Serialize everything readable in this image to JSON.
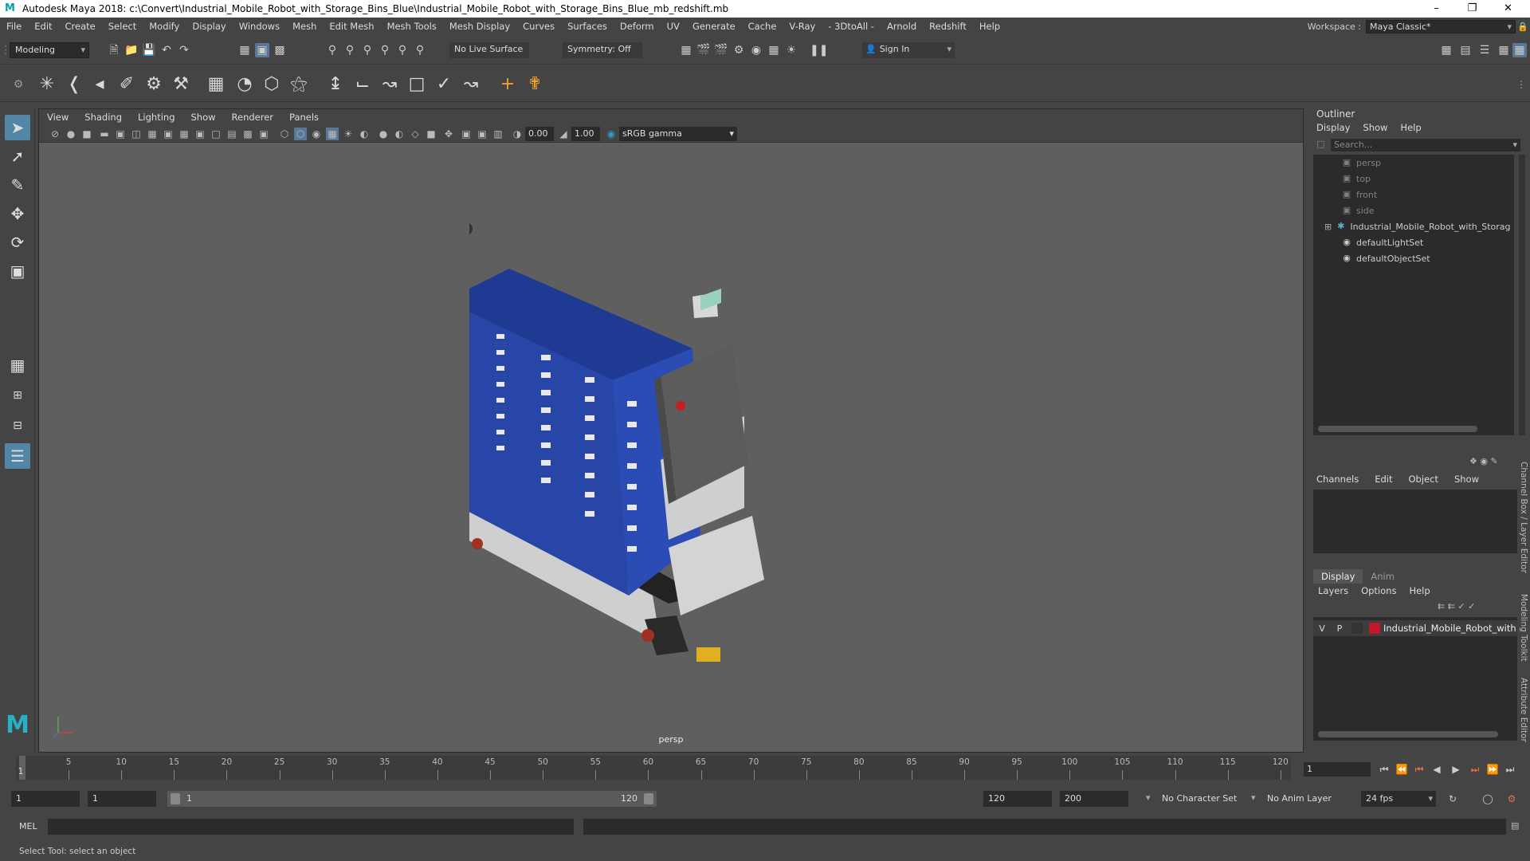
{
  "window": {
    "title": "Autodesk Maya 2018: c:\\Convert\\Industrial_Mobile_Robot_with_Storage_Bins_Blue\\Industrial_Mobile_Robot_with_Storage_Bins_Blue_mb_redshift.mb"
  },
  "menubar": {
    "items": [
      "File",
      "Edit",
      "Create",
      "Select",
      "Modify",
      "Display",
      "Windows",
      "Mesh",
      "Edit Mesh",
      "Mesh Tools",
      "Mesh Display",
      "Curves",
      "Surfaces",
      "Deform",
      "UV",
      "Generate",
      "Cache",
      "V-Ray",
      "- 3DtoAll -",
      "Arnold",
      "Redshift",
      "Help"
    ],
    "workspace_label": "Workspace :",
    "workspace_value": "Maya Classic*"
  },
  "statusline": {
    "mode": "Modeling",
    "live_surface": "No Live Surface",
    "symmetry": "Symmetry: Off",
    "sign_in": "Sign In"
  },
  "viewport": {
    "menu": [
      "View",
      "Shading",
      "Lighting",
      "Show",
      "Renderer",
      "Panels"
    ],
    "exposure": "0.00",
    "gamma": "1.00",
    "color_space": "sRGB gamma",
    "camera": "persp"
  },
  "outliner": {
    "title": "Outliner",
    "menu": [
      "Display",
      "Show",
      "Help"
    ],
    "search_placeholder": "Search...",
    "items": [
      {
        "label": "persp",
        "icon": "camera-icon",
        "dim": true
      },
      {
        "label": "top",
        "icon": "camera-icon",
        "dim": true
      },
      {
        "label": "front",
        "icon": "camera-icon",
        "dim": true
      },
      {
        "label": "side",
        "icon": "camera-icon",
        "dim": true
      },
      {
        "label": "Industrial_Mobile_Robot_with_Storage_",
        "icon": "transform-icon",
        "dim": false
      },
      {
        "label": "defaultLightSet",
        "icon": "set-icon",
        "dim": false
      },
      {
        "label": "defaultObjectSet",
        "icon": "set-icon",
        "dim": false
      }
    ]
  },
  "channelbox": {
    "menu": [
      "Channels",
      "Edit",
      "Object",
      "Show"
    ]
  },
  "layereditor": {
    "tabs": [
      "Display",
      "Anim"
    ],
    "menu": [
      "Layers",
      "Options",
      "Help"
    ],
    "layer": {
      "v": "V",
      "p": "P",
      "name": "Industrial_Mobile_Robot_with",
      "color": "#c0192c"
    }
  },
  "sidetabs": [
    "Channel Box / Layer Editor",
    "Modeling Toolkit",
    "Attribute Editor"
  ],
  "timeline": {
    "ticks": [
      5,
      10,
      15,
      20,
      25,
      30,
      35,
      40,
      45,
      50,
      55,
      60,
      65,
      70,
      75,
      80,
      85,
      90,
      95,
      100,
      105,
      110,
      115,
      120
    ],
    "start_label": "1",
    "current_frame": "1"
  },
  "range": {
    "start": "1",
    "playback_start": "1",
    "slider_start": "1",
    "slider_end": "120",
    "playback_end": "120",
    "end": "200",
    "character_set": "No Character Set",
    "anim_layer": "No Anim Layer",
    "fps": "24 fps"
  },
  "cmdline": {
    "label": "MEL"
  },
  "helpline": {
    "text": "Select Tool: select an object"
  }
}
